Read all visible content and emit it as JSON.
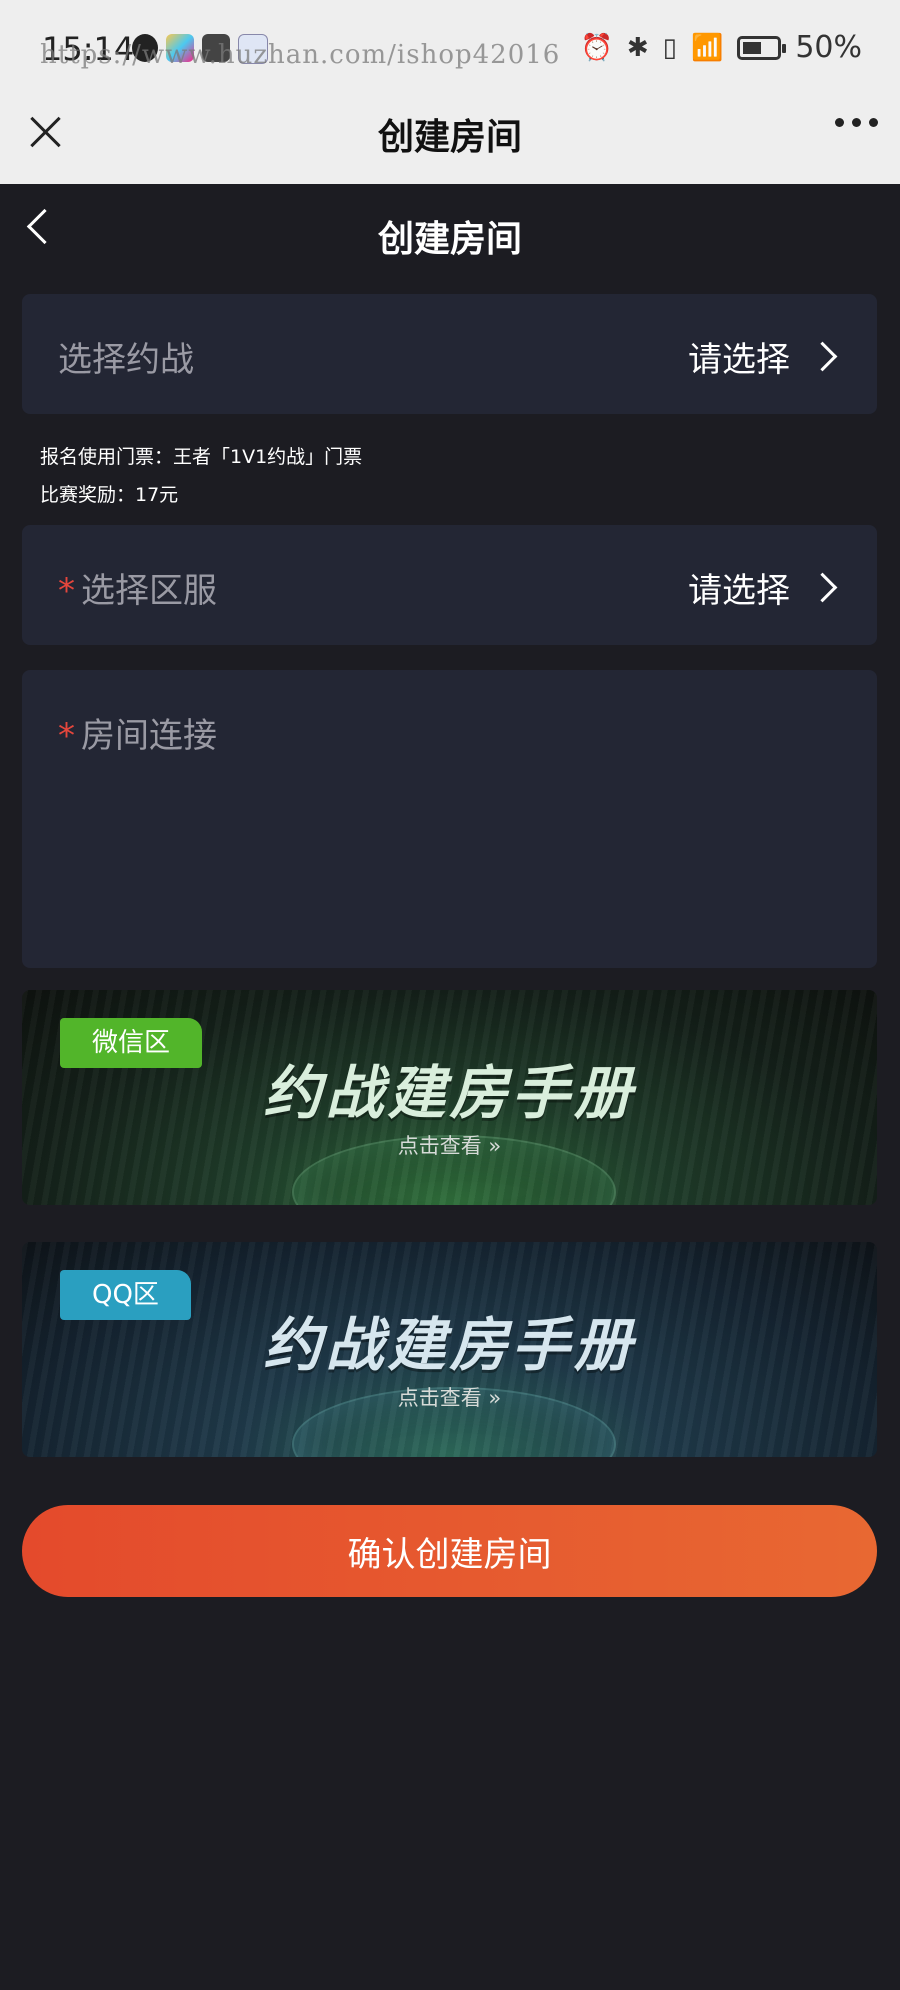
{
  "status_bar": {
    "time": "15:14",
    "watermark": "https://www.huzhan.com/ishop42016",
    "battery": "50%",
    "battery_level": 0.5
  },
  "top_nav": {
    "title": "创建房间"
  },
  "page_header": {
    "title": "创建房间"
  },
  "select_battle": {
    "label": "选择约战",
    "value": "请选择"
  },
  "notes": {
    "ticket": "报名使用门票：王者「1V1约战」门票",
    "reward": "比赛奖励：17元"
  },
  "select_server": {
    "required_mark": "*",
    "label": "选择区服",
    "value": "请选择"
  },
  "room_link": {
    "required_mark": "*",
    "label": "房间连接"
  },
  "banners": [
    {
      "tag": "微信区",
      "headline": "约战建房手册",
      "sub": "点击查看 »",
      "tag_color": "#52b52a"
    },
    {
      "tag": "QQ区",
      "headline": "约战建房手册",
      "sub": "点击查看 »",
      "tag_color": "#2a9fc0"
    }
  ],
  "confirm_button": {
    "label": "确认创建房间"
  },
  "colors": {
    "accent": "#e85a2e",
    "background": "#1c1c22",
    "card": "#232634",
    "required": "#e5463c"
  }
}
